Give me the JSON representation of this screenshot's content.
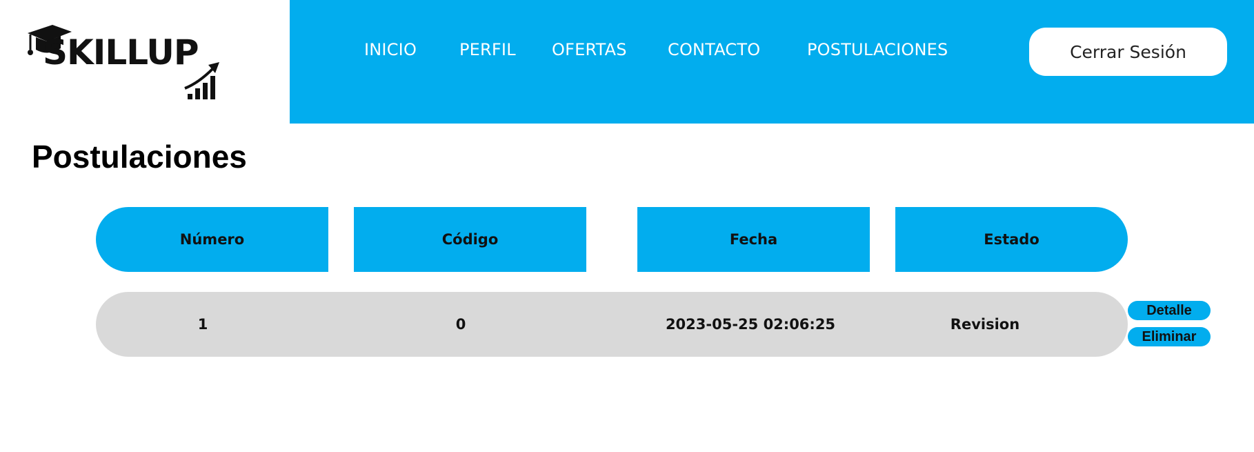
{
  "brand": {
    "name": "SKILLUP",
    "accent": "#02adee"
  },
  "nav": {
    "items": [
      {
        "label": "INICIO"
      },
      {
        "label": "PERFIL"
      },
      {
        "label": "OFERTAS"
      },
      {
        "label": "CONTACTO"
      },
      {
        "label": "POSTULACIONES"
      }
    ],
    "logout_label": "Cerrar Sesión"
  },
  "page": {
    "title": "Postulaciones"
  },
  "table": {
    "headers": [
      "Número",
      "Código",
      "Fecha",
      "Estado"
    ],
    "rows": [
      {
        "numero": "1",
        "codigo": "0",
        "fecha": "2023-05-25 02:06:25",
        "estado": "Revision",
        "actions": {
          "detail": "Detalle",
          "delete": "Eliminar"
        }
      }
    ]
  },
  "icons": [
    "graduation-cap-icon",
    "growth-chart-icon"
  ]
}
